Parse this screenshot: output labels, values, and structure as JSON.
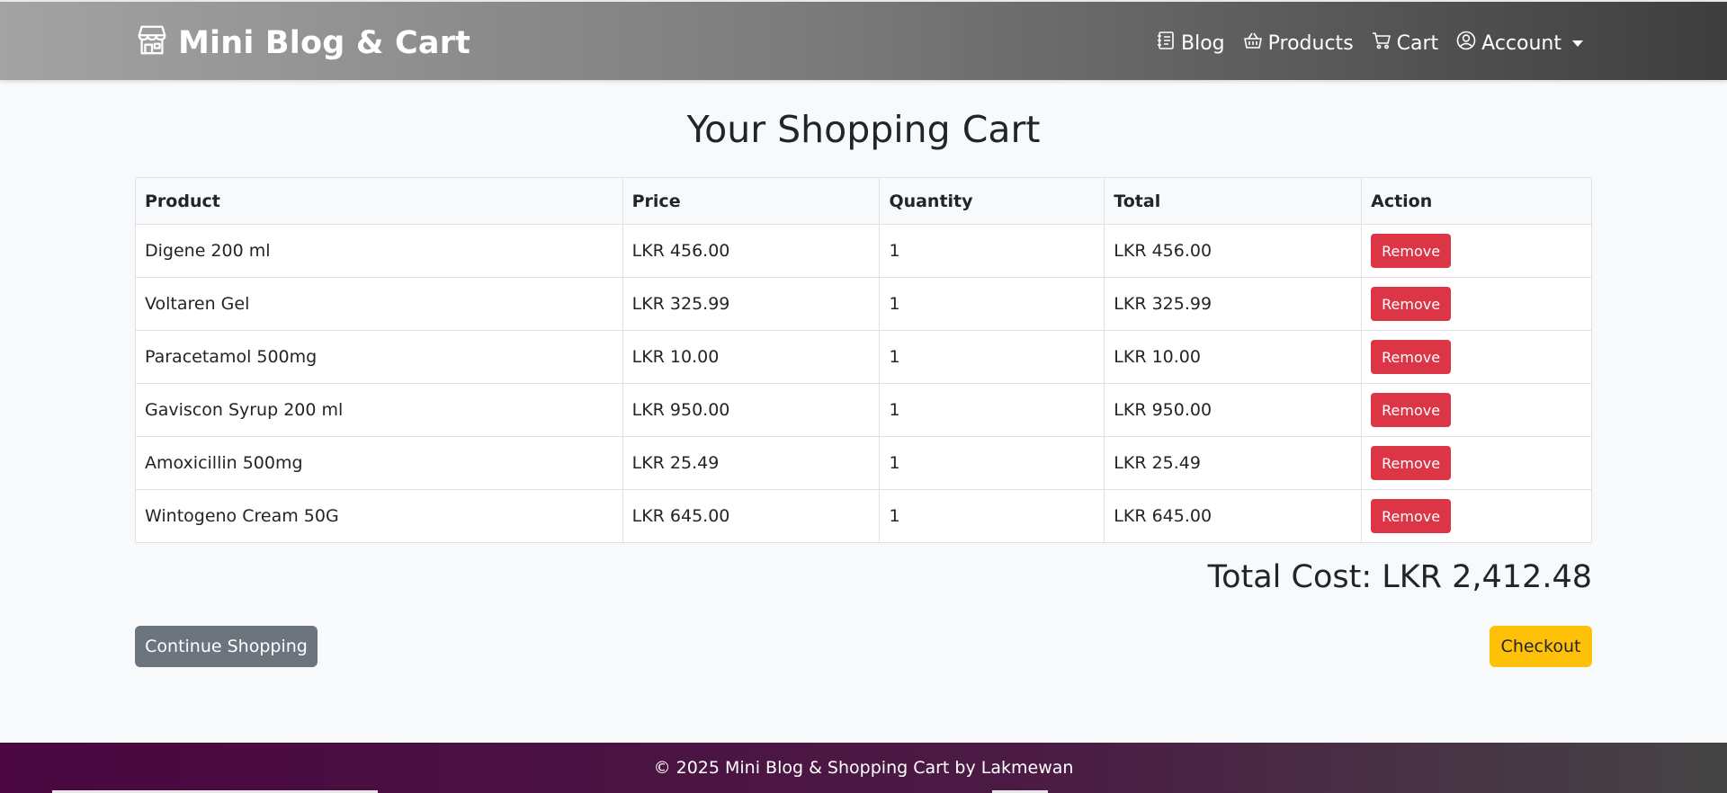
{
  "navbar": {
    "brand": "Mini Blog & Cart",
    "brand_icon": "shop-icon",
    "links": [
      {
        "label": "Blog",
        "icon": "journal-icon"
      },
      {
        "label": "Products",
        "icon": "basket-icon"
      },
      {
        "label": "Cart",
        "icon": "cart-icon"
      },
      {
        "label": "Account",
        "icon": "user-circle-icon"
      }
    ]
  },
  "page_title": "Your Shopping Cart",
  "table": {
    "headers": [
      "Product",
      "Price",
      "Quantity",
      "Total",
      "Action"
    ],
    "rows": [
      {
        "product": "Digene 200 ml",
        "price": "LKR 456.00",
        "quantity": "1",
        "total": "LKR 456.00",
        "action": "Remove"
      },
      {
        "product": "Voltaren Gel",
        "price": "LKR 325.99",
        "quantity": "1",
        "total": "LKR 325.99",
        "action": "Remove"
      },
      {
        "product": "Paracetamol 500mg",
        "price": "LKR 10.00",
        "quantity": "1",
        "total": "LKR 10.00",
        "action": "Remove"
      },
      {
        "product": "Gaviscon Syrup 200 ml",
        "price": "LKR 950.00",
        "quantity": "1",
        "total": "LKR 950.00",
        "action": "Remove"
      },
      {
        "product": "Amoxicillin 500mg",
        "price": "LKR 25.49",
        "quantity": "1",
        "total": "LKR 25.49",
        "action": "Remove"
      },
      {
        "product": "Wintogeno Cream 50G",
        "price": "LKR 645.00",
        "quantity": "1",
        "total": "LKR 645.00",
        "action": "Remove"
      }
    ]
  },
  "total_cost": "Total Cost: LKR 2,412.48",
  "buttons": {
    "continue": "Continue Shopping",
    "checkout": "Checkout"
  },
  "footer": "© 2025 Mini Blog & Shopping Cart by Lakmewan",
  "colors": {
    "danger": "#dc3545",
    "secondary": "#6c757d",
    "warning": "#ffc107"
  }
}
